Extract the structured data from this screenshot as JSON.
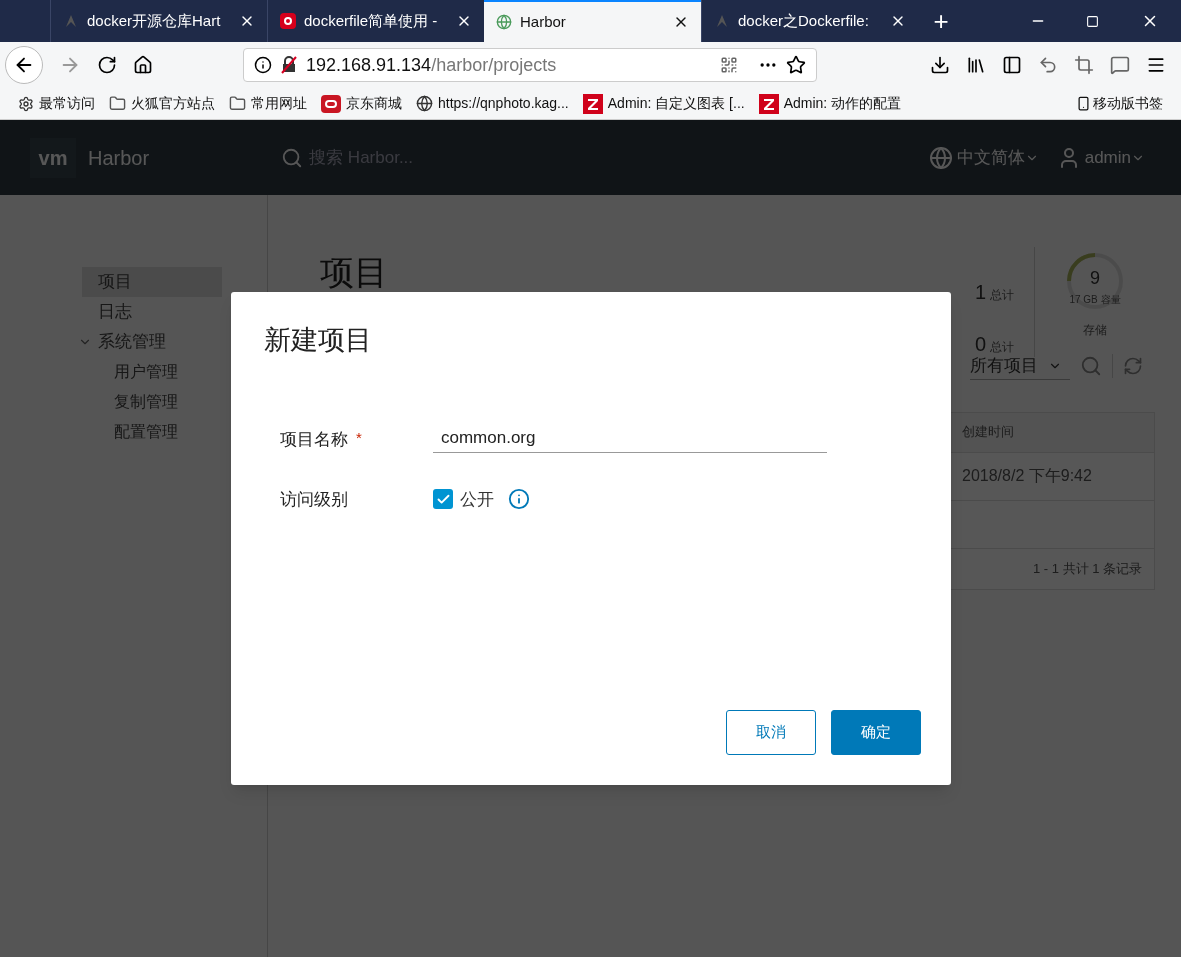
{
  "browser": {
    "tabs": [
      {
        "title": "docker开源仓库Hart",
        "selected": false,
        "kind": "shape"
      },
      {
        "title": "dockerfile简单使用 -",
        "selected": false,
        "kind": "c"
      },
      {
        "title": "Harbor",
        "selected": true,
        "kind": "globe"
      },
      {
        "title": "docker之Dockerfile:",
        "selected": false,
        "kind": "shape"
      }
    ],
    "new_tab": "+",
    "url_host": "192.168.91.134",
    "url_path": "/harbor/projects",
    "bookmarks": [
      {
        "label": "最常访问",
        "kind": "gear"
      },
      {
        "label": "火狐官方站点",
        "kind": "folder"
      },
      {
        "label": "常用网址",
        "kind": "folder"
      },
      {
        "label": "京东商城",
        "kind": "jd"
      },
      {
        "label": "https://qnphoto.kag...",
        "kind": "globe"
      },
      {
        "label": "Admin: 自定义图表 [...",
        "kind": "z"
      },
      {
        "label": "Admin: 动作的配置",
        "kind": "z"
      }
    ],
    "mobile_bookmarks": "移动版书签"
  },
  "app": {
    "logo": "vm",
    "name": "Harbor",
    "search_placeholder": "搜索 Harbor...",
    "language": "中文简体",
    "user": "admin",
    "sidebar": [
      {
        "label": "项目",
        "selected": true
      },
      {
        "label": "日志",
        "selected": false
      },
      {
        "label": "系统管理",
        "selected": false,
        "children": [
          {
            "label": "用户管理",
            "selected": false
          },
          {
            "label": "复制管理",
            "selected": false
          },
          {
            "label": "配置管理",
            "selected": false
          }
        ]
      }
    ],
    "page_title": "项目",
    "stats": [
      {
        "value": "1",
        "label": "总计"
      },
      {
        "value": "0",
        "label": "总计"
      }
    ],
    "storage": {
      "value": "9",
      "capacity": "17 GB 容量",
      "label": "存储",
      "level": 0.25
    },
    "filter": "所有项目",
    "table": {
      "columns": [
        "创建时间"
      ],
      "rows": [
        [
          "2018/8/2 下午9:42"
        ]
      ],
      "footer": "1 - 1 共计 1 条记录"
    }
  },
  "dialog": {
    "title": "新建项目",
    "name_label": "项目名称",
    "required_mark": "*",
    "name_value": "common.org",
    "access_label": "访问级别",
    "public_label": "公开",
    "public_checked": true,
    "buttons": [
      {
        "label": "取消",
        "kind": "secondary"
      },
      {
        "label": "确定",
        "kind": "primary"
      }
    ]
  }
}
